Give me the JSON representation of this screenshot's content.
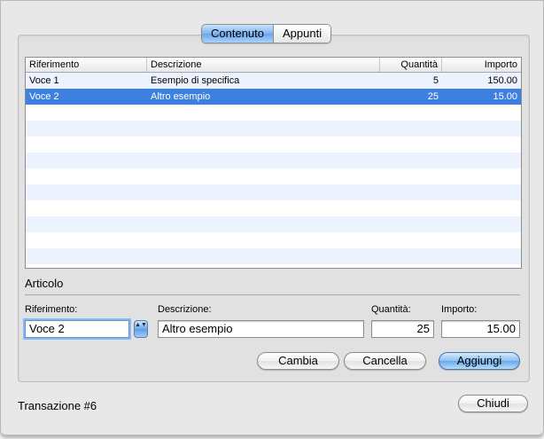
{
  "tabs": [
    {
      "label": "Contenuto",
      "active": true
    },
    {
      "label": "Appunti",
      "active": false
    }
  ],
  "table": {
    "columns": [
      "Riferimento",
      "Descrizione",
      "Quantità",
      "Importo"
    ],
    "rows": [
      {
        "ref": "Voce 1",
        "desc": "Esempio di specifica",
        "qty": "5",
        "amount": "150.00",
        "selected": false
      },
      {
        "ref": "Voce 2",
        "desc": "Altro esempio",
        "qty": "25",
        "amount": "15.00",
        "selected": true
      }
    ]
  },
  "form": {
    "section_title": "Articolo",
    "ref_label": "Riferimento:",
    "desc_label": "Descrizione:",
    "qty_label": "Quantità:",
    "amount_label": "Importo:",
    "ref_value": "Voce 2",
    "desc_value": "Altro esempio",
    "qty_value": "25",
    "amount_value": "15.00",
    "stepper_glyph": "▲▼"
  },
  "buttons": {
    "change": "Cambia",
    "delete": "Cancella",
    "add": "Aggiungi",
    "close": "Chiudi"
  },
  "status": "Transazione #6",
  "colors": {
    "selection": "#3d80df",
    "alt_row": "#edf3fe",
    "window_bg": "#e8e8e8",
    "default_button": "#6aa8ec"
  }
}
